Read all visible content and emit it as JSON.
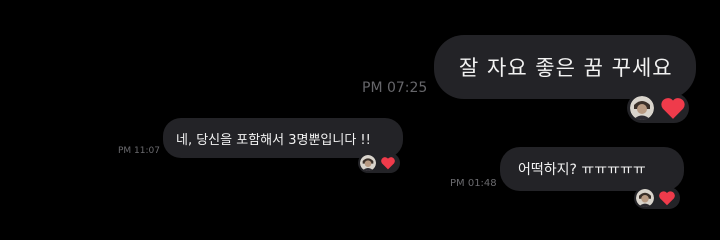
{
  "messages": [
    {
      "direction": "outgoing",
      "text": "잘 자요 좋은 꿈 꾸세요",
      "time": "PM 07:25",
      "reactions": [
        "avatar",
        "heart-icon"
      ]
    },
    {
      "direction": "incoming",
      "text": "네, 당신을 포함해서 3명뿐입니다 !!",
      "time": "PM 11:07",
      "reactions": [
        "avatar",
        "heart-icon"
      ]
    },
    {
      "direction": "outgoing",
      "text": "어떡하지? ㅠㅠㅠㅠㅠ",
      "time": "PM 01:48",
      "reactions": [
        "avatar",
        "heart-icon"
      ]
    }
  ],
  "colors": {
    "background": "#000000",
    "bubble": "#232327",
    "text": "#f2f2f2",
    "timestamp": "#6a6a6e",
    "heart": "#ef3b4b"
  }
}
